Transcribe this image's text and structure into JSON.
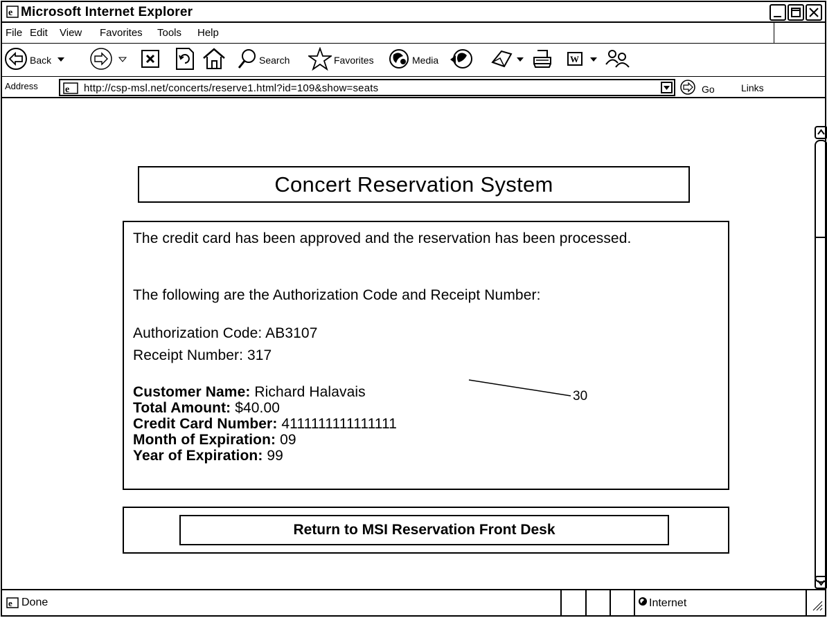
{
  "window": {
    "title": "Microsoft Internet Explorer"
  },
  "menu": {
    "items": [
      {
        "id": "file",
        "label": "File"
      },
      {
        "id": "edit",
        "label": "Edit"
      },
      {
        "id": "view",
        "label": "View"
      },
      {
        "id": "favorites",
        "label": "Favorites"
      },
      {
        "id": "tools",
        "label": "Tools"
      },
      {
        "id": "help",
        "label": "Help"
      }
    ]
  },
  "toolbar": {
    "back_label": "Back",
    "search_label": "Search",
    "favorites_label": "Favorites",
    "media_label": "Media",
    "icons": [
      "back-arrow-icon",
      "forward-arrow-icon",
      "stop-icon",
      "refresh-icon",
      "home-icon",
      "search-icon",
      "favorites-star-icon",
      "media-icon",
      "history-icon",
      "mail-icon",
      "print-icon",
      "word-icon",
      "messenger-icon"
    ]
  },
  "address_bar": {
    "label": "Address",
    "url": "http://csp-msl.net/concerts/reserve1.html?id=109&show=seats",
    "go_label": "Go",
    "links_label": "Links"
  },
  "page": {
    "title": "Concert Reservation System",
    "approved_msg": "The credit card has been approved and the reservation has been processed.",
    "following_msg": "The following are the Authorization Code and Receipt Number:",
    "authorization": {
      "label": "Authorization Code:",
      "value": "AB3107"
    },
    "receipt": {
      "label": "Receipt Number:",
      "value": "317"
    },
    "details": [
      {
        "label": "Customer Name:",
        "value": "Richard Halavais"
      },
      {
        "label": "Total Amount:",
        "value": "$40.00"
      },
      {
        "label": "Credit Card Number:",
        "value": "4111111111111111"
      },
      {
        "label": "Month of Expiration:",
        "value": "09"
      },
      {
        "label": "Year of Expiration:",
        "value": "99"
      }
    ],
    "return_button_label": "Return to MSI Reservation Front Desk",
    "annotation_ref": "30"
  },
  "status_bar": {
    "status_text": "Done",
    "zone_text": "Internet"
  }
}
